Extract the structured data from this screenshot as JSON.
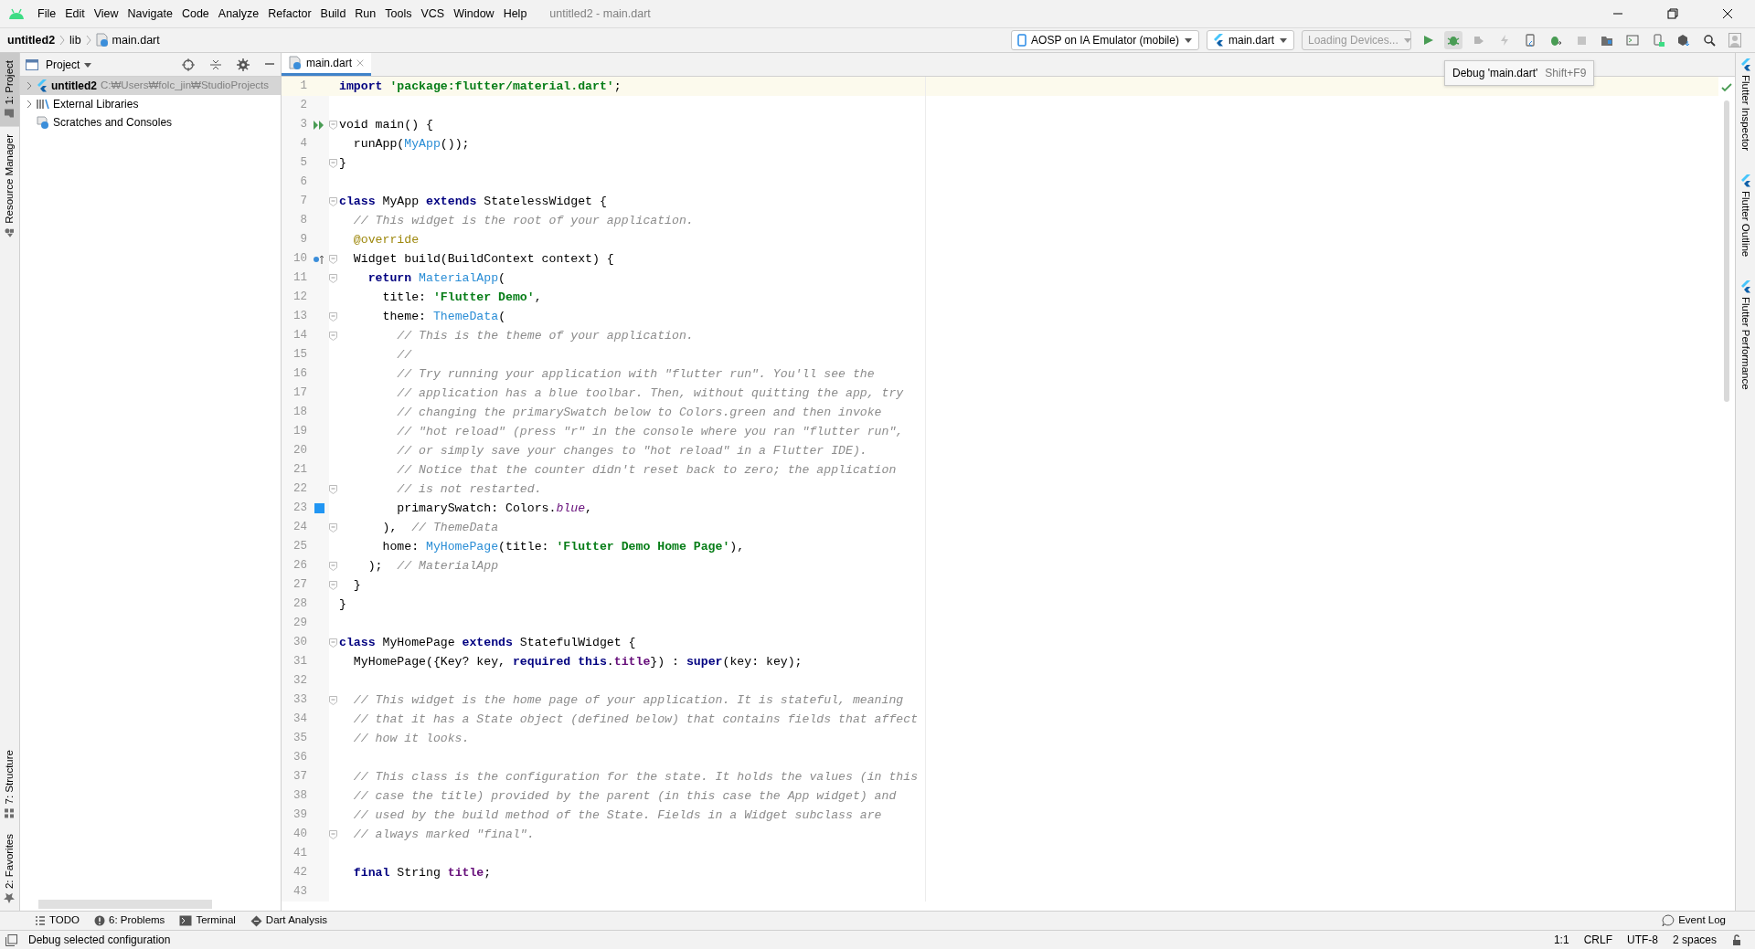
{
  "window": {
    "title": "untitled2 - main.dart"
  },
  "menu": [
    "File",
    "Edit",
    "View",
    "Navigate",
    "Code",
    "Analyze",
    "Refactor",
    "Build",
    "Run",
    "Tools",
    "VCS",
    "Window",
    "Help"
  ],
  "breadcrumbs": [
    "untitled2",
    "lib",
    "main.dart"
  ],
  "combos": [
    {
      "label": "AOSP on IA Emulator (mobile)",
      "kind": "device",
      "disabled": false
    },
    {
      "label": "main.dart",
      "kind": "config",
      "disabled": false
    },
    {
      "label": "Loading Devices...",
      "kind": "plain",
      "disabled": true
    }
  ],
  "tooltip": {
    "label": "Debug 'main.dart'",
    "shortcut": "Shift+F9"
  },
  "left_strip": {
    "top": [
      {
        "label": "1: Project",
        "selected": true
      },
      {
        "label": "Resource Manager",
        "selected": false
      }
    ],
    "bottom": [
      {
        "label": "7: Structure",
        "selected": false
      },
      {
        "label": "2: Favorites",
        "selected": false
      }
    ]
  },
  "right_strip": [
    {
      "label": "Flutter Inspector"
    },
    {
      "label": "Flutter Outline"
    },
    {
      "label": "Flutter Performance"
    }
  ],
  "project": {
    "title": "Project",
    "tree": [
      {
        "label": "untitled2",
        "path": "C:₩Users₩folc_jin₩StudioProjects",
        "kind": "project",
        "expanded": false,
        "selected": true
      },
      {
        "label": "External Libraries",
        "kind": "library",
        "expanded": false,
        "selected": false
      },
      {
        "label": "Scratches and Consoles",
        "kind": "scratches",
        "selected": false
      }
    ]
  },
  "editor": {
    "tabs": [
      {
        "label": "main.dart",
        "selected": true
      }
    ],
    "lines": [
      {
        "n": "1",
        "cur": true,
        "fold": false,
        "spans": [
          {
            "text": "import",
            "kind": "keyword"
          },
          {
            "text": " 'package:flutter/material.dart'",
            "kind": "string"
          },
          {
            "text": ";",
            "kind": "plain"
          }
        ]
      },
      {
        "n": "2",
        "cur": false,
        "fold": false
      },
      {
        "n": "3",
        "cur": false,
        "fold": true,
        "marker": {
          "kind": "run"
        },
        "spans": [
          {
            "text": "void main() {",
            "kind": "plain"
          }
        ]
      },
      {
        "n": "4",
        "cur": false,
        "fold": false,
        "spans": [
          {
            "text": "  runApp(",
            "kind": "plain"
          },
          {
            "text": "MyApp",
            "kind": "class"
          },
          {
            "text": "());",
            "kind": "plain"
          }
        ]
      },
      {
        "n": "5",
        "cur": false,
        "fold": true,
        "spans": [
          {
            "text": "}",
            "kind": "plain"
          }
        ]
      },
      {
        "n": "6",
        "cur": false,
        "fold": false
      },
      {
        "n": "7",
        "cur": false,
        "fold": true,
        "spans": [
          {
            "text": "class",
            "kind": "keyword"
          },
          {
            "text": " MyApp ",
            "kind": "plain"
          },
          {
            "text": "extends",
            "kind": "keyword"
          },
          {
            "text": " StatelessWidget {",
            "kind": "plain"
          }
        ]
      },
      {
        "n": "8",
        "cur": false,
        "fold": false,
        "spans": [
          {
            "text": "  // This widget is the root of your application.",
            "kind": "comment"
          }
        ]
      },
      {
        "n": "9",
        "cur": false,
        "fold": false,
        "spans": [
          {
            "text": "  @override",
            "kind": "annotation"
          }
        ]
      },
      {
        "n": "10",
        "cur": false,
        "fold": true,
        "marker": {
          "kind": "override"
        },
        "spans": [
          {
            "text": "  Widget build(BuildContext context) {",
            "kind": "plain"
          }
        ]
      },
      {
        "n": "11",
        "cur": false,
        "fold": true,
        "spans": [
          {
            "text": "    return",
            "kind": "keyword"
          },
          {
            "text": " MaterialApp",
            "kind": "class"
          },
          {
            "text": "(",
            "kind": "plain"
          }
        ]
      },
      {
        "n": "12",
        "cur": false,
        "fold": false,
        "spans": [
          {
            "text": "      title: ",
            "kind": "plain"
          },
          {
            "text": "'Flutter Demo'",
            "kind": "string"
          },
          {
            "text": ",",
            "kind": "plain"
          }
        ]
      },
      {
        "n": "13",
        "cur": false,
        "fold": true,
        "spans": [
          {
            "text": "      theme: ",
            "kind": "plain"
          },
          {
            "text": "ThemeData",
            "kind": "class"
          },
          {
            "text": "(",
            "kind": "plain"
          }
        ]
      },
      {
        "n": "14",
        "cur": false,
        "fold": true,
        "spans": [
          {
            "text": "        // This is the theme of your application.",
            "kind": "comment"
          }
        ]
      },
      {
        "n": "15",
        "cur": false,
        "fold": false,
        "spans": [
          {
            "text": "        //",
            "kind": "comment"
          }
        ]
      },
      {
        "n": "16",
        "cur": false,
        "fold": false,
        "spans": [
          {
            "text": "        // Try running your application with \"flutter run\". You'll see the",
            "kind": "comment"
          }
        ]
      },
      {
        "n": "17",
        "cur": false,
        "fold": false,
        "spans": [
          {
            "text": "        // application has a blue toolbar. Then, without quitting the app, try",
            "kind": "comment"
          }
        ]
      },
      {
        "n": "18",
        "cur": false,
        "fold": false,
        "spans": [
          {
            "text": "        // changing the primarySwatch below to Colors.green and then invoke",
            "kind": "comment"
          }
        ]
      },
      {
        "n": "19",
        "cur": false,
        "fold": false,
        "spans": [
          {
            "text": "        // \"hot reload\" (press \"r\" in the console where you ran \"flutter run\",",
            "kind": "comment"
          }
        ]
      },
      {
        "n": "20",
        "cur": false,
        "fold": false,
        "spans": [
          {
            "text": "        // or simply save your changes to \"hot reload\" in a Flutter IDE).",
            "kind": "comment"
          }
        ]
      },
      {
        "n": "21",
        "cur": false,
        "fold": false,
        "spans": [
          {
            "text": "        // Notice that the counter didn't reset back to zero; the application",
            "kind": "comment"
          }
        ]
      },
      {
        "n": "22",
        "cur": false,
        "fold": true,
        "spans": [
          {
            "text": "        // is not restarted.",
            "kind": "comment"
          }
        ]
      },
      {
        "n": "23",
        "cur": false,
        "fold": false,
        "marker": {
          "kind": "color",
          "color": "#2196f3"
        },
        "spans": [
          {
            "text": "        primarySwatch: Colors.",
            "kind": "plain"
          },
          {
            "text": "blue",
            "kind": "constant"
          },
          {
            "text": ",",
            "kind": "plain"
          }
        ]
      },
      {
        "n": "24",
        "cur": false,
        "fold": true,
        "spans": [
          {
            "text": "      ),",
            "kind": "plain"
          },
          {
            "text": "  // ThemeData",
            "kind": "comment"
          }
        ]
      },
      {
        "n": "25",
        "cur": false,
        "fold": false,
        "spans": [
          {
            "text": "      home: ",
            "kind": "plain"
          },
          {
            "text": "MyHomePage",
            "kind": "class"
          },
          {
            "text": "(title: ",
            "kind": "plain"
          },
          {
            "text": "'Flutter Demo Home Page'",
            "kind": "string"
          },
          {
            "text": "),",
            "kind": "plain"
          }
        ]
      },
      {
        "n": "26",
        "cur": false,
        "fold": true,
        "spans": [
          {
            "text": "    );",
            "kind": "plain"
          },
          {
            "text": "  // MaterialApp",
            "kind": "comment"
          }
        ]
      },
      {
        "n": "27",
        "cur": false,
        "fold": true,
        "spans": [
          {
            "text": "  }",
            "kind": "plain"
          }
        ]
      },
      {
        "n": "28",
        "cur": false,
        "fold": false,
        "spans": [
          {
            "text": "}",
            "kind": "plain"
          }
        ]
      },
      {
        "n": "29",
        "cur": false,
        "fold": false
      },
      {
        "n": "30",
        "cur": false,
        "fold": true,
        "spans": [
          {
            "text": "class",
            "kind": "keyword"
          },
          {
            "text": " MyHomePage ",
            "kind": "plain"
          },
          {
            "text": "extends",
            "kind": "keyword"
          },
          {
            "text": " StatefulWidget {",
            "kind": "plain"
          }
        ]
      },
      {
        "n": "31",
        "cur": false,
        "fold": false,
        "spans": [
          {
            "text": "  MyHomePage({Key? key, ",
            "kind": "plain"
          },
          {
            "text": "required",
            "kind": "keyword"
          },
          {
            "text": " this",
            "kind": "keyword"
          },
          {
            "text": ".",
            "kind": "plain"
          },
          {
            "text": "title",
            "kind": "field"
          },
          {
            "text": "}) : ",
            "kind": "plain"
          },
          {
            "text": "super",
            "kind": "keyword"
          },
          {
            "text": "(key: key);",
            "kind": "plain"
          }
        ]
      },
      {
        "n": "32",
        "cur": false,
        "fold": false
      },
      {
        "n": "33",
        "cur": false,
        "fold": true,
        "spans": [
          {
            "text": "  // This widget is the home page of your application. It is stateful, meaning",
            "kind": "comment"
          }
        ]
      },
      {
        "n": "34",
        "cur": false,
        "fold": false,
        "spans": [
          {
            "text": "  // that it has a State object (defined below) that contains fields that affect",
            "kind": "comment"
          }
        ]
      },
      {
        "n": "35",
        "cur": false,
        "fold": false,
        "spans": [
          {
            "text": "  // how it looks.",
            "kind": "comment"
          }
        ]
      },
      {
        "n": "36",
        "cur": false,
        "fold": false
      },
      {
        "n": "37",
        "cur": false,
        "fold": false,
        "spans": [
          {
            "text": "  // This class is the configuration for the state. It holds the values (in this",
            "kind": "comment"
          }
        ]
      },
      {
        "n": "38",
        "cur": false,
        "fold": false,
        "spans": [
          {
            "text": "  // case the title) provided by the parent (in this case the App widget) and",
            "kind": "comment"
          }
        ]
      },
      {
        "n": "39",
        "cur": false,
        "fold": false,
        "spans": [
          {
            "text": "  // used by the build method of the State. Fields in a Widget subclass are",
            "kind": "comment"
          }
        ]
      },
      {
        "n": "40",
        "cur": false,
        "fold": true,
        "spans": [
          {
            "text": "  // always marked \"final\".",
            "kind": "comment"
          }
        ]
      },
      {
        "n": "41",
        "cur": false,
        "fold": false
      },
      {
        "n": "42",
        "cur": false,
        "fold": false,
        "spans": [
          {
            "text": "  final",
            "kind": "keyword"
          },
          {
            "text": " String ",
            "kind": "plain"
          },
          {
            "text": "title",
            "kind": "field"
          },
          {
            "text": ";",
            "kind": "plain"
          }
        ]
      },
      {
        "n": "43",
        "cur": false,
        "fold": false
      }
    ]
  },
  "tool_windows": [
    {
      "label": "TODO"
    },
    {
      "label": "6: Problems"
    },
    {
      "label": "Terminal"
    },
    {
      "label": "Dart Analysis"
    }
  ],
  "event_log": "Event Log",
  "status_bar": {
    "message": "Debug selected configuration",
    "items": [
      "1:1",
      "CRLF",
      "UTF-8",
      "2 spaces"
    ]
  }
}
